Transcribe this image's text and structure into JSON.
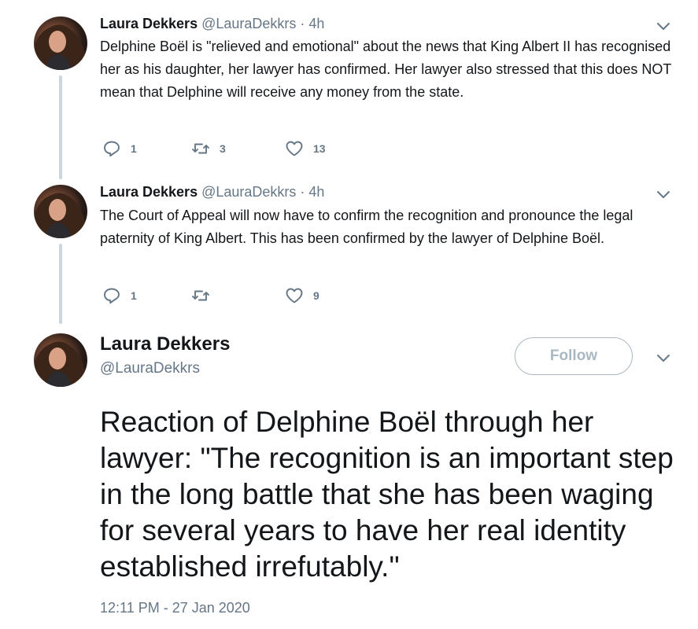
{
  "thread": [
    {
      "author_name": "Laura Dekkers",
      "handle_time": "@LauraDekkrs · 4h",
      "text": "Delphine Boël is \"relieved and emotional\" about the news that King Albert II has recognised her as his daughter, her lawyer has confirmed. Her lawyer also stressed that this does NOT mean that Delphine will receive any money from the state.",
      "replies": "1",
      "retweets": "3",
      "likes": "13"
    },
    {
      "author_name": "Laura Dekkers",
      "handle_time": "@LauraDekkrs · 4h",
      "text": "The Court of Appeal will now have to confirm the recognition and pronounce the legal paternity of King Albert. This has been confirmed by the lawyer of Delphine Boël.",
      "replies": "1",
      "retweets": "",
      "likes": "9"
    }
  ],
  "main_tweet": {
    "author_name": "Laura Dekkers",
    "handle": "@LauraDekkrs",
    "follow_label": "Follow",
    "text": "Reaction of Delphine Boël through her lawyer: \"The recognition is an important step in the long battle that she has been waging for several years to have her real identity established irrefutably.\"",
    "timestamp": "12:11 PM - 27 Jan 2020"
  },
  "colors": {
    "text_primary": "#14171a",
    "text_secondary": "#657786",
    "thread_line": "#ccd6dd",
    "follow_border": "#aab8c2"
  },
  "icons": {
    "reply": "reply-icon",
    "retweet": "retweet-icon",
    "like": "heart-icon",
    "more": "chevron-down-icon"
  }
}
